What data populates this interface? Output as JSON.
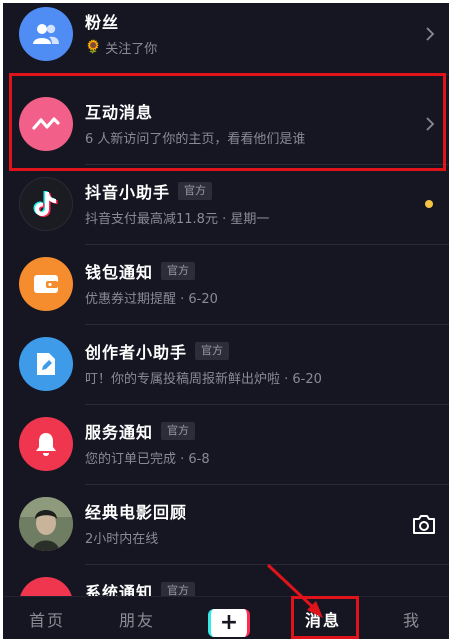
{
  "messages": [
    {
      "title": "粉丝",
      "tag": "",
      "emoji": "🌻",
      "subtitle": "关注了你"
    },
    {
      "title": "互动消息",
      "tag": "",
      "emoji": "",
      "subtitle": "6 人新访问了你的主页，看看他们是谁"
    },
    {
      "title": "抖音小助手",
      "tag": "官方",
      "emoji": "",
      "subtitle": "抖音支付最高减11.8元 · 星期一"
    },
    {
      "title": "钱包通知",
      "tag": "官方",
      "emoji": "",
      "subtitle": "优惠券过期提醒 · 6-20"
    },
    {
      "title": "创作者小助手",
      "tag": "官方",
      "emoji": "",
      "subtitle": "叮！你的专属投稿周报新鲜出炉啦 · 6-20"
    },
    {
      "title": "服务通知",
      "tag": "官方",
      "emoji": "",
      "subtitle": "您的订单已完成 · 6-8"
    },
    {
      "title": "经典电影回顾",
      "tag": "",
      "emoji": "",
      "subtitle": "2小时内在线"
    },
    {
      "title": "系统通知",
      "tag": "官方",
      "emoji": "",
      "subtitle": ""
    }
  ],
  "tabbar": {
    "home": "首页",
    "friends": "朋友",
    "plus": "+",
    "messages": "消息",
    "me": "我"
  },
  "colors": {
    "background": "#161622",
    "unread_dot": "#f6c445",
    "annotation_red": "#e0131a"
  }
}
